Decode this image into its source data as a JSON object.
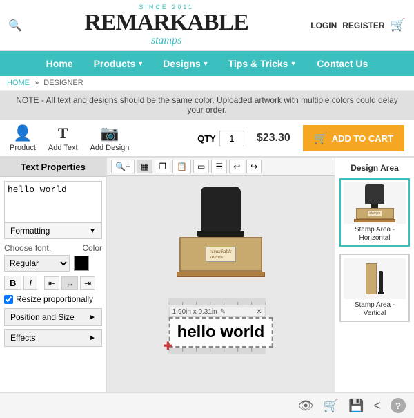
{
  "header": {
    "since": "SINCE 2011",
    "logo": "REMARKABLE",
    "stamps": "stamps",
    "login": "LOGIN",
    "register": "REGISTER"
  },
  "nav": {
    "items": [
      {
        "label": "Home",
        "hasDropdown": false
      },
      {
        "label": "Products",
        "hasDropdown": true
      },
      {
        "label": "Designs",
        "hasDropdown": true
      },
      {
        "label": "Tips & Tricks",
        "hasDropdown": true
      },
      {
        "label": "Contact Us",
        "hasDropdown": false
      }
    ]
  },
  "breadcrumb": {
    "home": "HOME",
    "separator": "»",
    "current": "DESIGNER"
  },
  "notice": "NOTE - All text and designs should be the same color. Uploaded artwork with multiple colors could delay your order.",
  "toolbar": {
    "product_label": "Product",
    "add_text_label": "Add Text",
    "add_design_label": "Add Design",
    "qty_label": "QTY",
    "qty_value": "1",
    "price": "$23.30",
    "add_to_cart": "ADD TO CART"
  },
  "left_panel": {
    "title": "Text Properties",
    "text_value": "hello world",
    "formatting_label": "Formatting",
    "font_label": "Choose font.",
    "color_label": "Color",
    "font_value": "Regular",
    "bold_label": "B",
    "italic_label": "I",
    "resize_label": "Resize proportionally",
    "position_size_label": "Position and Size",
    "effects_label": "Effects"
  },
  "canvas": {
    "dimensions_label": "1.90in x 0.31in",
    "text_content": "hello world"
  },
  "right_panel": {
    "title": "Design Area",
    "option1_label": "Stamp Area - Horizontal",
    "option2_label": "Stamp Area - Vertical"
  },
  "bottom_bar": {
    "icons": [
      "eye",
      "cart",
      "save",
      "share",
      "help"
    ]
  }
}
